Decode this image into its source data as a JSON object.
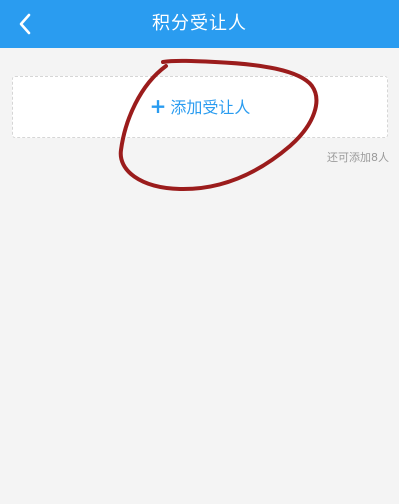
{
  "header": {
    "title": "积分受让人",
    "back_icon": "chevron-left-icon",
    "background_color": "#2a9cf0"
  },
  "add_transferee": {
    "plus_symbol": "+",
    "label": "添加受让人",
    "text_color": "#2a9cf0"
  },
  "remaining_hint": "还可添加8人",
  "annotation": {
    "type": "hand-drawn-circle",
    "color": "#9b1c1c"
  }
}
